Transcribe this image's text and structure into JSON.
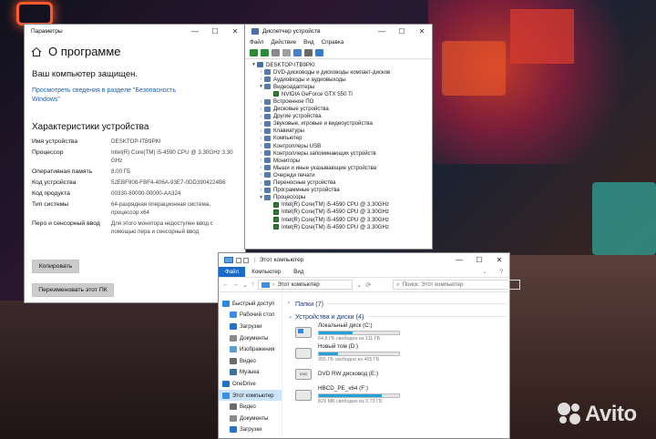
{
  "params_window": {
    "title": "Параметры",
    "controls": [
      "—",
      "☐",
      "✕"
    ],
    "heading": "О программе",
    "protection_status": "Ваш компьютер защищен.",
    "security_link": "Просмотреть сведения в разделе \"Безопасность Windows\"",
    "specs_heading": "Характеристики устройства",
    "specs": [
      {
        "label": "Имя устройства",
        "value": "DESKTOP-ITB9PKI"
      },
      {
        "label": "Процессор",
        "value": "Intel(R) Core(TM) i5-4590 CPU @ 3.30GHz 3.30 GHz"
      },
      {
        "label": "Оперативная память",
        "value": "8,00 ГБ"
      },
      {
        "label": "Код устройства",
        "value": "52EBF908-FBF4-406A-93E7-0DD3904224B6"
      },
      {
        "label": "Код продукта",
        "value": "00330-80000-00000-AA324"
      },
      {
        "label": "Тип системы",
        "value": "64-разрядная операционная система, процессор x64"
      },
      {
        "label": "Перо и сенсорный ввод",
        "value": "Для этого монитора недоступен ввод с помощью пера и сенсорный ввод"
      }
    ],
    "copy_button": "Копировать",
    "rename_button": "Переименовать этот ПК"
  },
  "device_manager": {
    "title": "Диспетчер устройств",
    "controls": [
      "—",
      "☐",
      "✕"
    ],
    "menu": [
      "Файл",
      "Действие",
      "Вид",
      "Справка"
    ],
    "root": "DESKTOP-ITB9PKI",
    "tree": [
      {
        "label": "DVD-дисководы и дисководы компакт-дисков",
        "level": 1,
        "expanded": false
      },
      {
        "label": "Аудиовходы и аудиовыходы",
        "level": 1,
        "expanded": false
      },
      {
        "label": "Видеоадаптеры",
        "level": 1,
        "expanded": true
      },
      {
        "label": "NVIDIA GeForce GTX 550 Ti",
        "level": 2,
        "expanded": false
      },
      {
        "label": "Встроенное ПО",
        "level": 1,
        "expanded": false
      },
      {
        "label": "Дисковые устройства",
        "level": 1,
        "expanded": false
      },
      {
        "label": "Другие устройства",
        "level": 1,
        "expanded": false
      },
      {
        "label": "Звуковые, игровые и видеоустройства",
        "level": 1,
        "expanded": false
      },
      {
        "label": "Клавиатуры",
        "level": 1,
        "expanded": false
      },
      {
        "label": "Компьютер",
        "level": 1,
        "expanded": false
      },
      {
        "label": "Контроллеры USB",
        "level": 1,
        "expanded": false
      },
      {
        "label": "Контроллеры запоминающих устройств",
        "level": 1,
        "expanded": false
      },
      {
        "label": "Мониторы",
        "level": 1,
        "expanded": false
      },
      {
        "label": "Мыши и иные указывающие устройства",
        "level": 1,
        "expanded": false
      },
      {
        "label": "Очереди печати",
        "level": 1,
        "expanded": false
      },
      {
        "label": "Переносные устройства",
        "level": 1,
        "expanded": false
      },
      {
        "label": "Программные устройства",
        "level": 1,
        "expanded": false
      },
      {
        "label": "Процессоры",
        "level": 1,
        "expanded": true
      },
      {
        "label": "Intel(R) Core(TM) i5-4590 CPU @ 3.30GHz",
        "level": 2,
        "expanded": false
      },
      {
        "label": "Intel(R) Core(TM) i5-4590 CPU @ 3.30GHz",
        "level": 2,
        "expanded": false
      },
      {
        "label": "Intel(R) Core(TM) i5-4590 CPU @ 3.30GHz",
        "level": 2,
        "expanded": false
      },
      {
        "label": "Intel(R) Core(TM) i5-4590 CPU @ 3.30GHz",
        "level": 2,
        "expanded": false
      }
    ]
  },
  "explorer": {
    "title": "Этот компьютер",
    "controls": [
      "—",
      "☐",
      "✕"
    ],
    "ribbon": [
      "Файл",
      "Компьютер",
      "Вид"
    ],
    "address": "Этот компьютер",
    "search_placeholder": "Поиск: Этот компьютер",
    "nav": [
      {
        "label": "Быстрый доступ",
        "icon": "star-icon",
        "color": "#2a8be0"
      },
      {
        "label": "Рабочий стол",
        "icon": "desktop-icon",
        "color": "#3a8ee6"
      },
      {
        "label": "Загрузки",
        "icon": "download-icon",
        "color": "#2a6fc9"
      },
      {
        "label": "Документы",
        "icon": "document-icon",
        "color": "#8a8a8a"
      },
      {
        "label": "Изображения",
        "icon": "image-icon",
        "color": "#5a9fd4"
      },
      {
        "label": "Видео",
        "icon": "video-icon",
        "color": "#6b6b6b"
      },
      {
        "label": "Музыка",
        "icon": "music-icon",
        "color": "#3a6ea5"
      },
      {
        "label": "OneDrive",
        "icon": "cloud-icon",
        "color": "#1e73c9"
      },
      {
        "label": "Этот компьютер",
        "icon": "computer-icon",
        "color": "#3a8ee6",
        "selected": true
      },
      {
        "label": "Видео",
        "icon": "video-icon",
        "color": "#6b6b6b"
      },
      {
        "label": "Документы",
        "icon": "document-icon",
        "color": "#8a8a8a"
      },
      {
        "label": "Загрузки",
        "icon": "download-icon",
        "color": "#2a6fc9"
      }
    ],
    "folders_group": "Папки (7)",
    "devices_group": "Устройства и диски (4)",
    "drives": [
      {
        "name": "Локальный диск (C:)",
        "free": "64,8 ГБ свободно из 111 ГБ",
        "used_fraction": 0.42,
        "type": "system"
      },
      {
        "name": "Новый том (D:)",
        "free": "355 ГБ свободно из 465 ГБ",
        "used_fraction": 0.24,
        "type": "hdd"
      },
      {
        "name": "DVD RW дисковод (E:)",
        "free": "",
        "used_fraction": null,
        "type": "dvd",
        "dvd_label": "DVD"
      },
      {
        "name": "HBCD_PE_x64 (F:)",
        "free": "829 МБ свободно из 3,73 ГБ",
        "used_fraction": 0.78,
        "type": "usb"
      }
    ]
  },
  "watermark": {
    "text": "Avito"
  }
}
